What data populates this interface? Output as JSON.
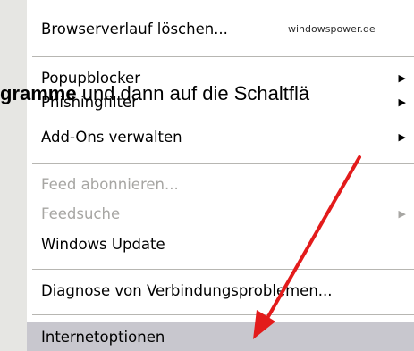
{
  "watermark": "windowspower.de",
  "menu": {
    "items": [
      {
        "label": "Browserverlauf löschen...",
        "disabled": false
      },
      {
        "label": "Popupblocker",
        "disabled": false
      },
      {
        "label": "Phishingfilter",
        "disabled": false
      },
      {
        "label": "Add-Ons verwalten",
        "disabled": false
      },
      {
        "label": "Feed abonnieren...",
        "disabled": true
      },
      {
        "label": "Feedsuche",
        "disabled": true
      },
      {
        "label": "Windows Update",
        "disabled": false
      },
      {
        "label": "Diagnose von Verbindungsproblemen...",
        "disabled": false
      },
      {
        "label": "Internetoptionen",
        "disabled": false,
        "highlighted": true
      }
    ],
    "submenu_glyph": "▶"
  },
  "overlay_text": {
    "bold": "gramme",
    "rest": " und dann auf die Schaltflä"
  },
  "colors": {
    "highlight": "#c8c7ce",
    "icon_strip": "#e6e6e3",
    "disabled_text": "#a7a6a3",
    "annotation_arrow": "#e31b1b"
  }
}
